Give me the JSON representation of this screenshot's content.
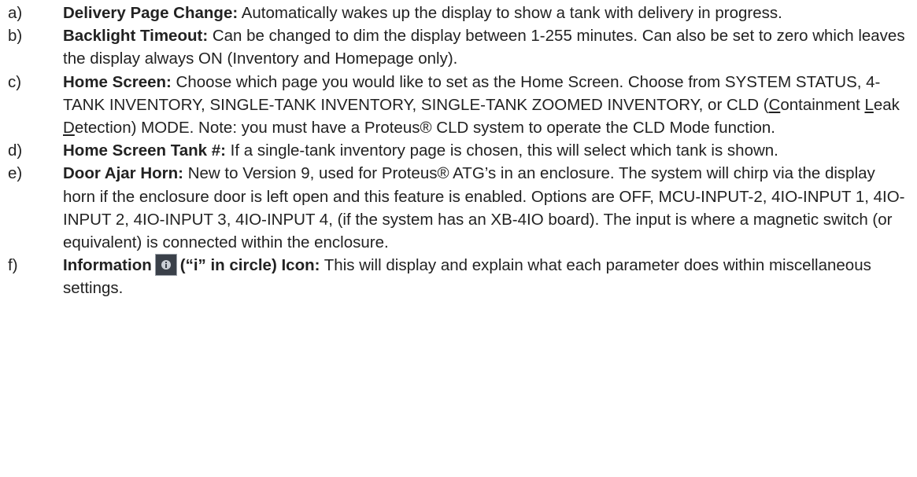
{
  "items": [
    {
      "marker": "a)",
      "lead": "Delivery Page Change:",
      "text": " Automatically wakes up the display to show a tank with delivery in progress."
    },
    {
      "marker": "b)",
      "lead": "Backlight Timeout:",
      "text": " Can be changed to dim the display between 1-255 minutes.  Can also be set to zero which leaves the display always ON (Inventory and Homepage only)."
    },
    {
      "marker": "c)",
      "lead": "Home Screen:",
      "text_1": " Choose which page you would like to set as the Home Screen.  Choose from SYSTEM STATUS, 4-TANK INVENTORY, SINGLE-TANK INVENTORY, SINGLE-TANK ZOOMED INVENTORY, or CLD (",
      "u_c": "C",
      "text_2": "ontainment ",
      "u_l": "L",
      "text_3": "eak ",
      "u_d": "D",
      "text_4": "etection) MODE. Note: you must have a Proteus® CLD system to operate the CLD Mode function."
    },
    {
      "marker": "d)",
      "lead": "Home Screen Tank #:",
      "text": " If a single-tank inventory page is chosen, this will select which tank is shown."
    },
    {
      "marker": "e)",
      "lead": "Door Ajar Horn:",
      "text": " New to Version 9, used for Proteus® ATG’s in an enclosure. The system will chirp via the display horn if the enclosure door is left open and this feature is enabled. Options are OFF, MCU-INPUT-2, 4IO-INPUT 1, 4IO-INPUT 2, 4IO-INPUT 3, 4IO-INPUT 4, (if the system has an XB-4IO board). The input is where a magnetic switch (or equivalent) is connected within the enclosure."
    },
    {
      "marker": "f)",
      "lead_1": "Information",
      "icon": "info-circle-icon",
      "lead_2": "(“i” in circle) Icon:",
      "text": " This will display and explain what each parameter does within miscellaneous settings."
    }
  ]
}
